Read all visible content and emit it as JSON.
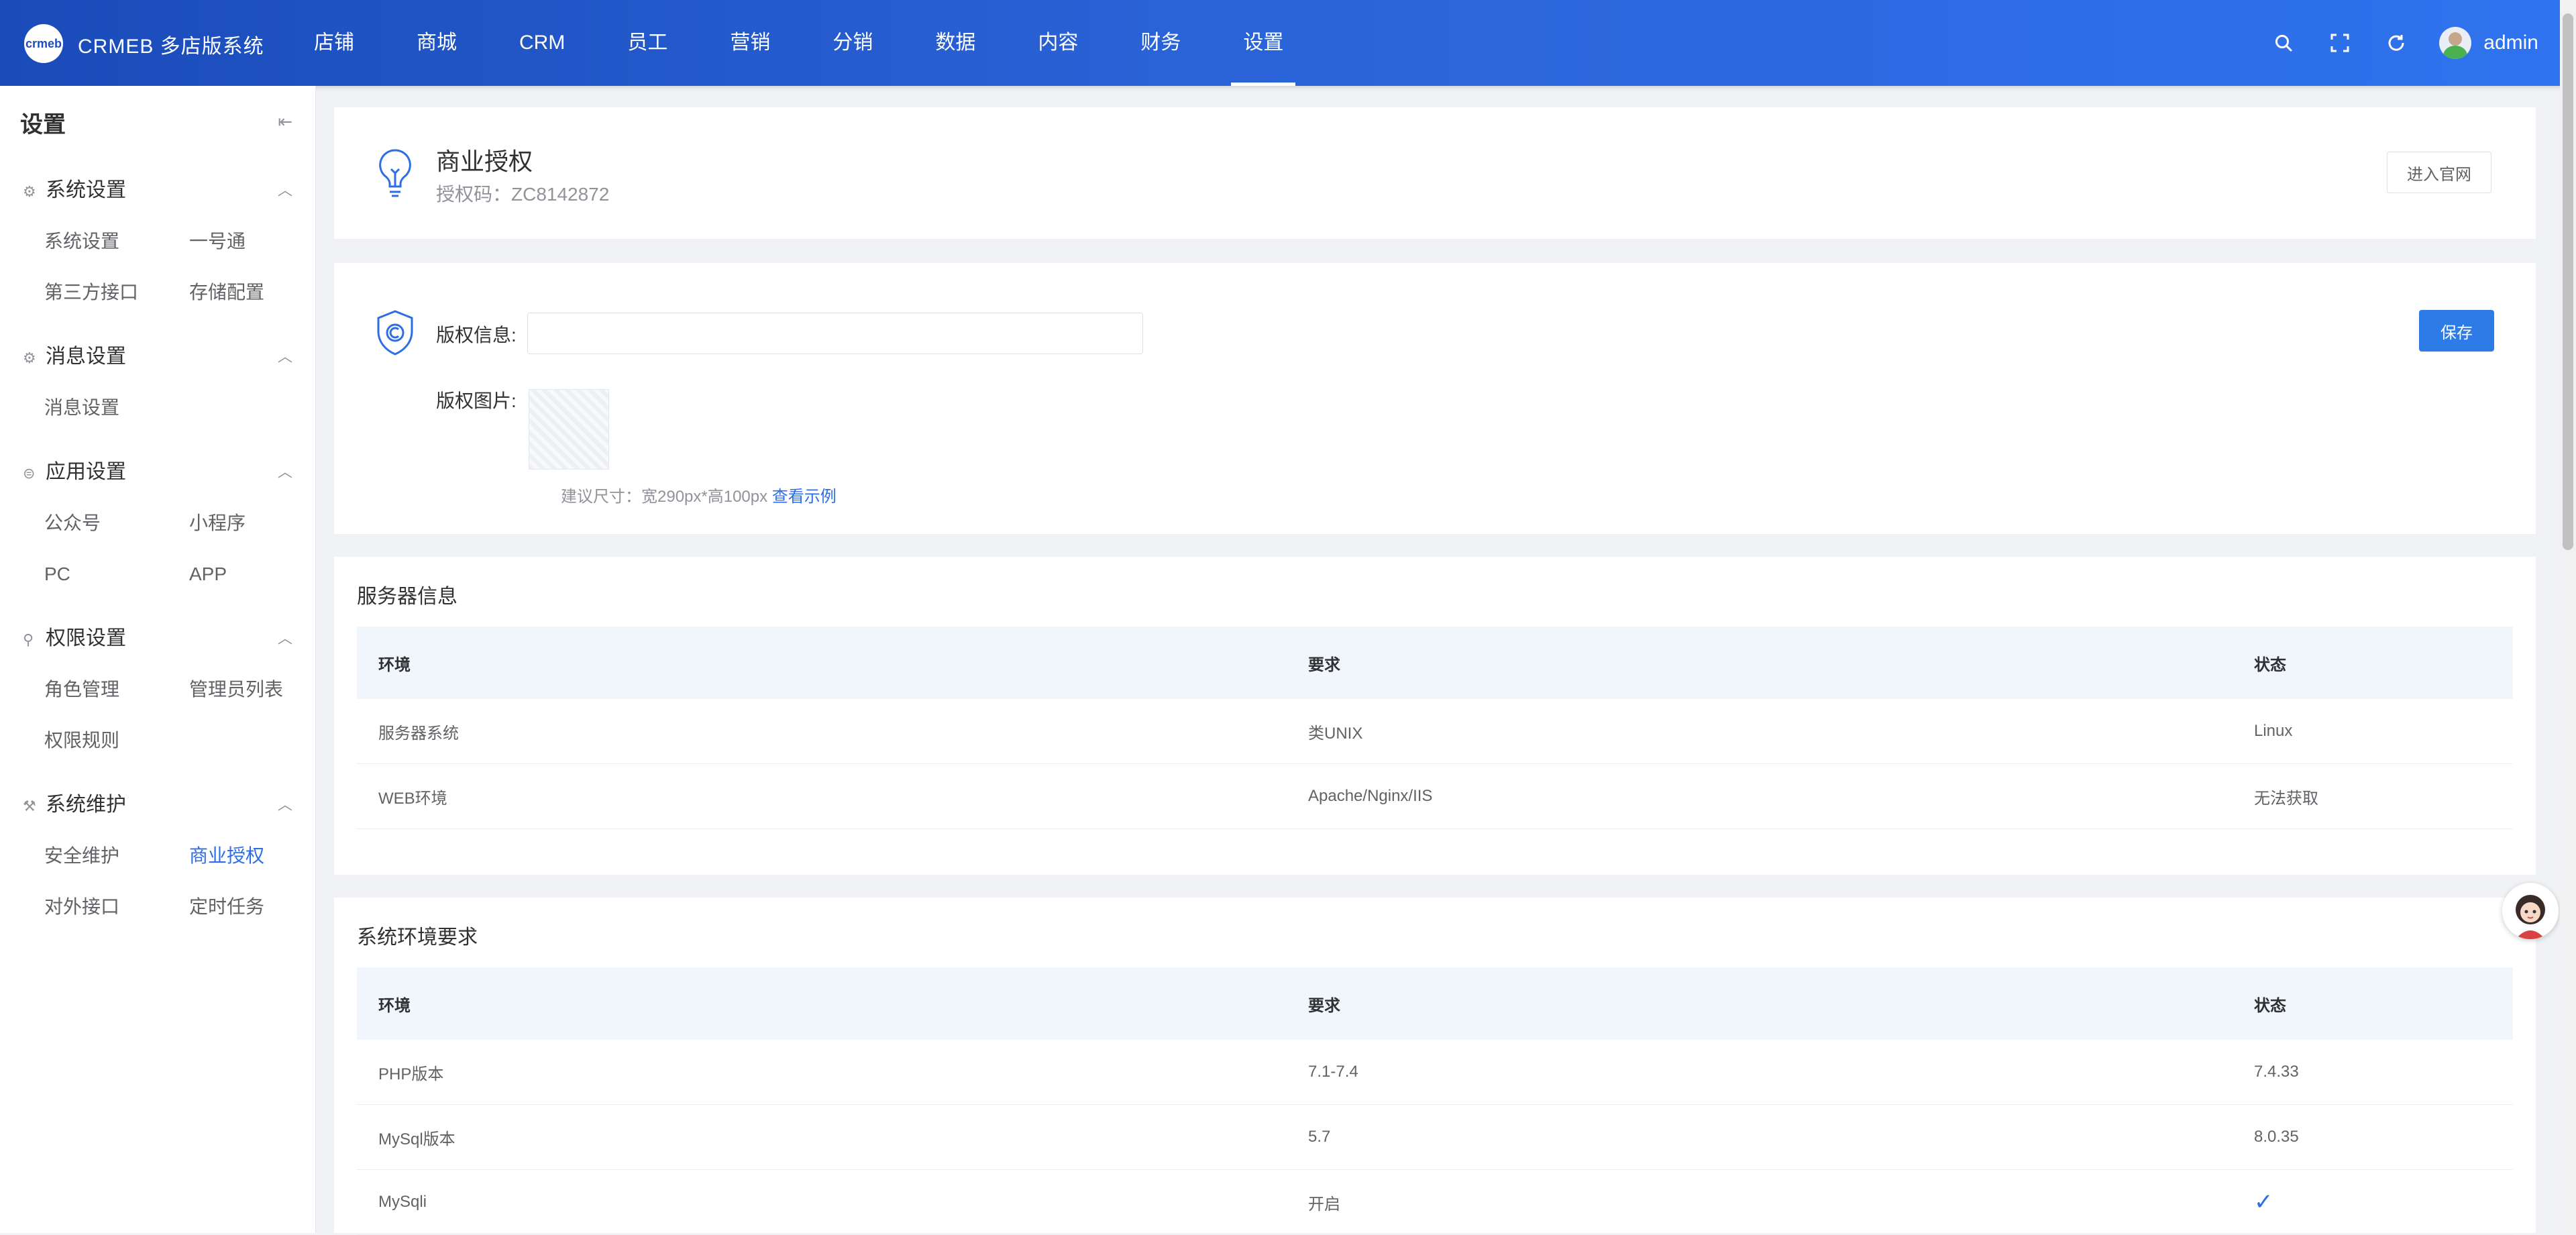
{
  "app": {
    "logo_text": "crmeb",
    "brand": "CRMEB 多店版系统"
  },
  "nav": [
    "店铺",
    "商城",
    "CRM",
    "员工",
    "营销",
    "分销",
    "数据",
    "内容",
    "财务",
    "设置"
  ],
  "nav_active": "设置",
  "user": {
    "name": "admin"
  },
  "sidebar": {
    "title": "设置",
    "groups": [
      {
        "label": "系统设置",
        "icon": "gear-icon",
        "items": [
          "系统设置",
          "一号通",
          "第三方接口",
          "存储配置"
        ]
      },
      {
        "label": "消息设置",
        "icon": "gear-icon",
        "items": [
          "消息设置"
        ]
      },
      {
        "label": "应用设置",
        "icon": "app-icon",
        "items": [
          "公众号",
          "小程序",
          "PC",
          "APP"
        ]
      },
      {
        "label": "权限设置",
        "icon": "user-icon",
        "items": [
          "角色管理",
          "管理员列表",
          "权限规则"
        ]
      },
      {
        "label": "系统维护",
        "icon": "tools-icon",
        "items": [
          "安全维护",
          "商业授权",
          "对外接口",
          "定时任务"
        ]
      }
    ],
    "active_item": "商业授权"
  },
  "license": {
    "title": "商业授权",
    "code": "授权码：ZC8142872",
    "visit_button": "进入官网"
  },
  "copyright": {
    "info_label": "版权信息:",
    "info_value": "",
    "image_label": "版权图片:",
    "hint": "建议尺寸：宽290px*高100px",
    "hint_link": "查看示例",
    "save_button": "保存"
  },
  "server_info": {
    "title": "服务器信息",
    "columns": [
      "环境",
      "要求",
      "状态"
    ],
    "rows": [
      [
        "服务器系统",
        "类UNIX",
        "Linux"
      ],
      [
        "WEB环境",
        "Apache/Nginx/IIS",
        "无法获取"
      ]
    ]
  },
  "env_req": {
    "title": "系统环境要求",
    "columns": [
      "环境",
      "要求",
      "状态"
    ],
    "rows": [
      [
        "PHP版本",
        "7.1-7.4",
        "7.4.33"
      ],
      [
        "MySql版本",
        "5.7",
        "8.0.35"
      ],
      [
        "MySqli",
        "开启",
        "✓"
      ]
    ]
  },
  "colors": {
    "primary": "#2d7be6",
    "topbar": "#2a62d7"
  }
}
